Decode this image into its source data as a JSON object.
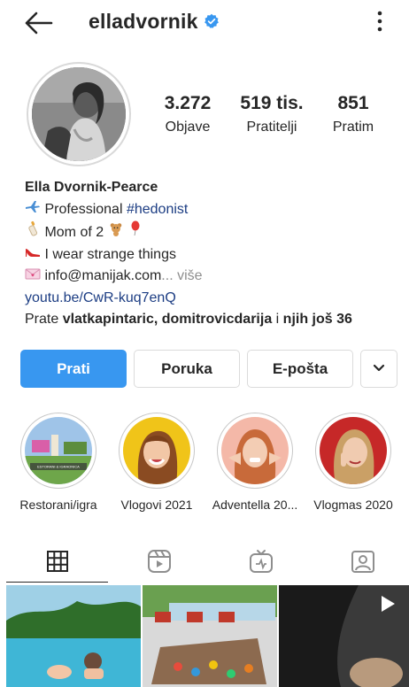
{
  "header": {
    "username": "elladvornik",
    "back_icon": "back-arrow-icon",
    "verified_icon": "verified-badge-icon",
    "more_icon": "more-vertical-icon",
    "verified_color": "#3897f0"
  },
  "stats": {
    "posts_count": "3.272",
    "posts_label": "Objave",
    "followers_count": "519 tis.",
    "followers_label": "Pratitelji",
    "following_count": "851",
    "following_label": "Pratim"
  },
  "bio": {
    "full_name": "Ella Dvornik-Pearce",
    "line1_prefix": "Professional ",
    "line1_hashtag": "#hedonist",
    "line2": "Mom of 2",
    "line3": "I wear strange things",
    "line4_email": "info@manijak.com",
    "line4_more": "... više",
    "link": "youtu.be/CwR-kuq7enQ",
    "followed_by_prefix": "Prate ",
    "followed_by_names": "vlatkapintaric, domitrovicdarija",
    "followed_by_and": " i ",
    "followed_by_more": "njih još 36"
  },
  "actions": {
    "follow_label": "Prati",
    "message_label": "Poruka",
    "email_label": "E-pošta",
    "dropdown_icon": "chevron-down-icon",
    "primary_color": "#3897f0"
  },
  "highlights": [
    {
      "caption": "Restorani/igra",
      "pic_sign": "ESTORANI & IGRAONICA"
    },
    {
      "caption": "Vlogovi 2021"
    },
    {
      "caption": "Adventella 20..."
    },
    {
      "caption": "Vlogmas 2020"
    }
  ],
  "tabs": [
    {
      "icon": "grid-icon",
      "active": true
    },
    {
      "icon": "reels-icon",
      "active": false
    },
    {
      "icon": "igtv-icon",
      "active": false
    },
    {
      "icon": "tagged-icon",
      "active": false
    }
  ]
}
